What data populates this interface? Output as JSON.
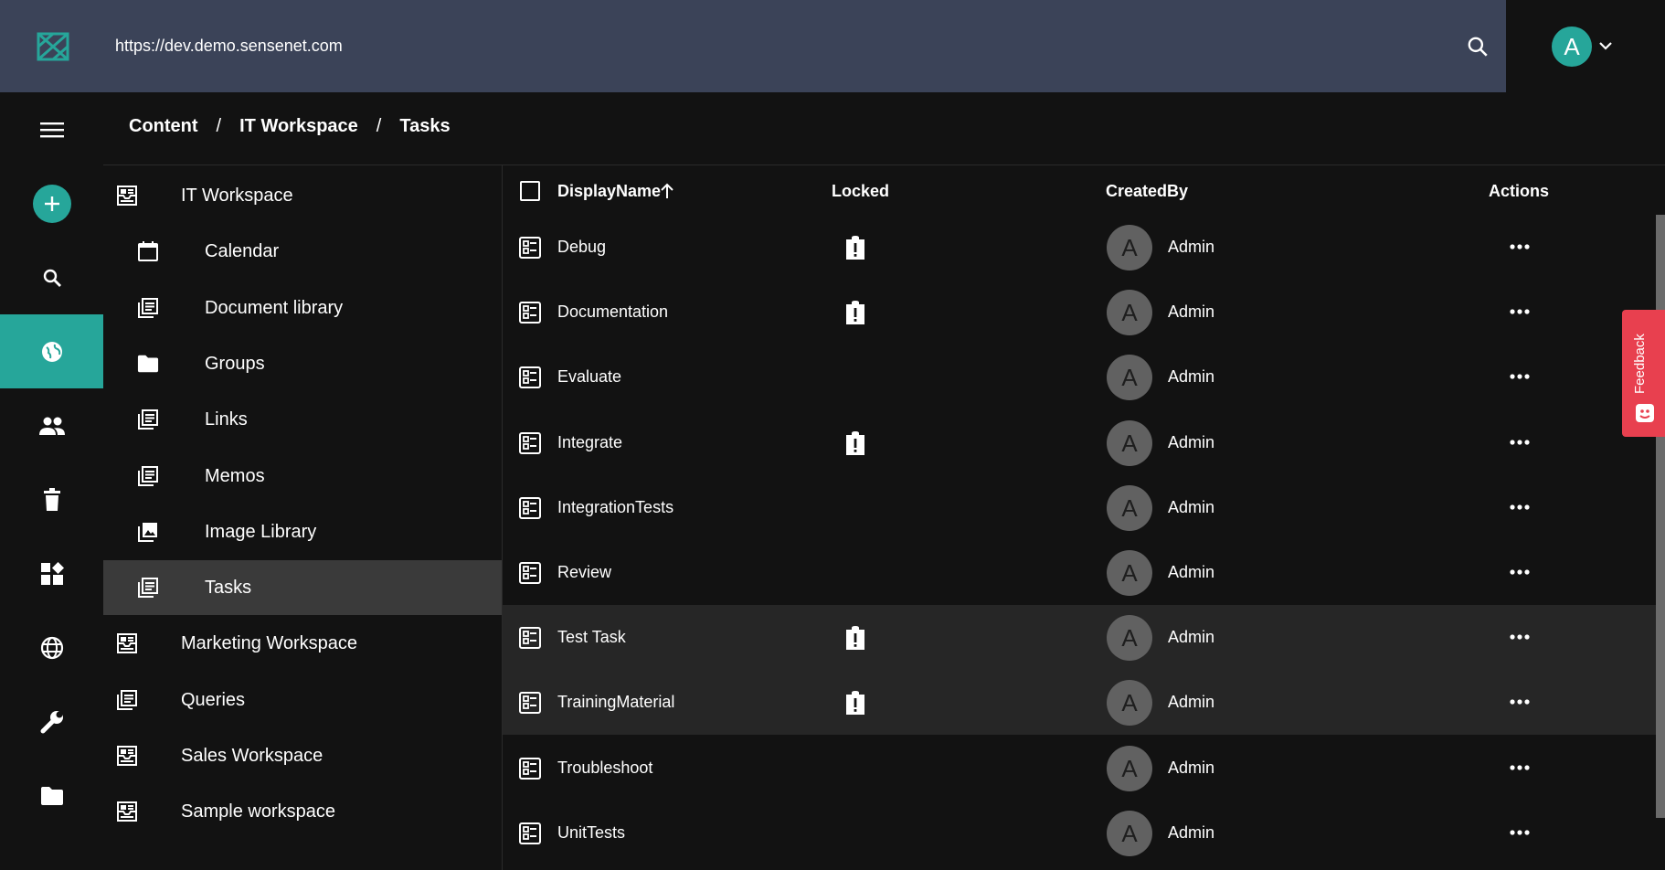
{
  "header": {
    "url": "https://dev.demo.sensenet.com",
    "user_initial": "A"
  },
  "nav": {
    "items": [
      {
        "icon": "menu-icon"
      },
      {
        "icon": "add-icon"
      },
      {
        "icon": "search-icon"
      },
      {
        "icon": "globe-icon",
        "active": true
      },
      {
        "icon": "users-icon"
      },
      {
        "icon": "trash-icon"
      },
      {
        "icon": "dashboard-icon"
      },
      {
        "icon": "localization-globe-icon"
      },
      {
        "icon": "wrench-icon"
      },
      {
        "icon": "folder-icon"
      }
    ]
  },
  "breadcrumb": [
    "Content",
    "IT Workspace",
    "Tasks"
  ],
  "breadcrumb_sep": "/",
  "tree": [
    {
      "label": "IT Workspace",
      "icon": "workspace-icon",
      "level": 0
    },
    {
      "label": "Calendar",
      "icon": "calendar-icon",
      "level": 1
    },
    {
      "label": "Document library",
      "icon": "list-icon",
      "level": 1
    },
    {
      "label": "Groups",
      "icon": "folder-icon",
      "level": 1
    },
    {
      "label": "Links",
      "icon": "list-icon",
      "level": 1
    },
    {
      "label": "Memos",
      "icon": "list-icon",
      "level": 1
    },
    {
      "label": "Image Library",
      "icon": "image-library-icon",
      "level": 1
    },
    {
      "label": "Tasks",
      "icon": "list-icon",
      "level": 1,
      "selected": true
    },
    {
      "label": "Marketing Workspace",
      "icon": "workspace-icon",
      "level": 0
    },
    {
      "label": "Queries",
      "icon": "list-icon",
      "level": 0
    },
    {
      "label": "Sales Workspace",
      "icon": "workspace-icon",
      "level": 0
    },
    {
      "label": "Sample workspace",
      "icon": "workspace-icon",
      "level": 0
    }
  ],
  "table": {
    "columns": {
      "display_name": "DisplayName",
      "locked": "Locked",
      "created_by": "CreatedBy",
      "actions": "Actions"
    },
    "rows": [
      {
        "name": "Debug",
        "locked": true,
        "creator": "Admin",
        "initial": "A"
      },
      {
        "name": "Documentation",
        "locked": true,
        "creator": "Admin",
        "initial": "A"
      },
      {
        "name": "Evaluate",
        "locked": false,
        "creator": "Admin",
        "initial": "A"
      },
      {
        "name": "Integrate",
        "locked": true,
        "creator": "Admin",
        "initial": "A"
      },
      {
        "name": "IntegrationTests",
        "locked": false,
        "creator": "Admin",
        "initial": "A"
      },
      {
        "name": "Review",
        "locked": false,
        "creator": "Admin",
        "initial": "A"
      },
      {
        "name": "Test Task",
        "locked": true,
        "creator": "Admin",
        "initial": "A",
        "highlighted": true
      },
      {
        "name": "TrainingMaterial",
        "locked": true,
        "creator": "Admin",
        "initial": "A",
        "highlighted": true
      },
      {
        "name": "Troubleshoot",
        "locked": false,
        "creator": "Admin",
        "initial": "A"
      },
      {
        "name": "UnitTests",
        "locked": false,
        "creator": "Admin",
        "initial": "A"
      }
    ]
  },
  "feedback_label": "Feedback",
  "colors": {
    "topbar": "#3b4358",
    "accent": "#26a69a",
    "feedback": "#e8404f",
    "selected_row": "#3a3a3a"
  }
}
